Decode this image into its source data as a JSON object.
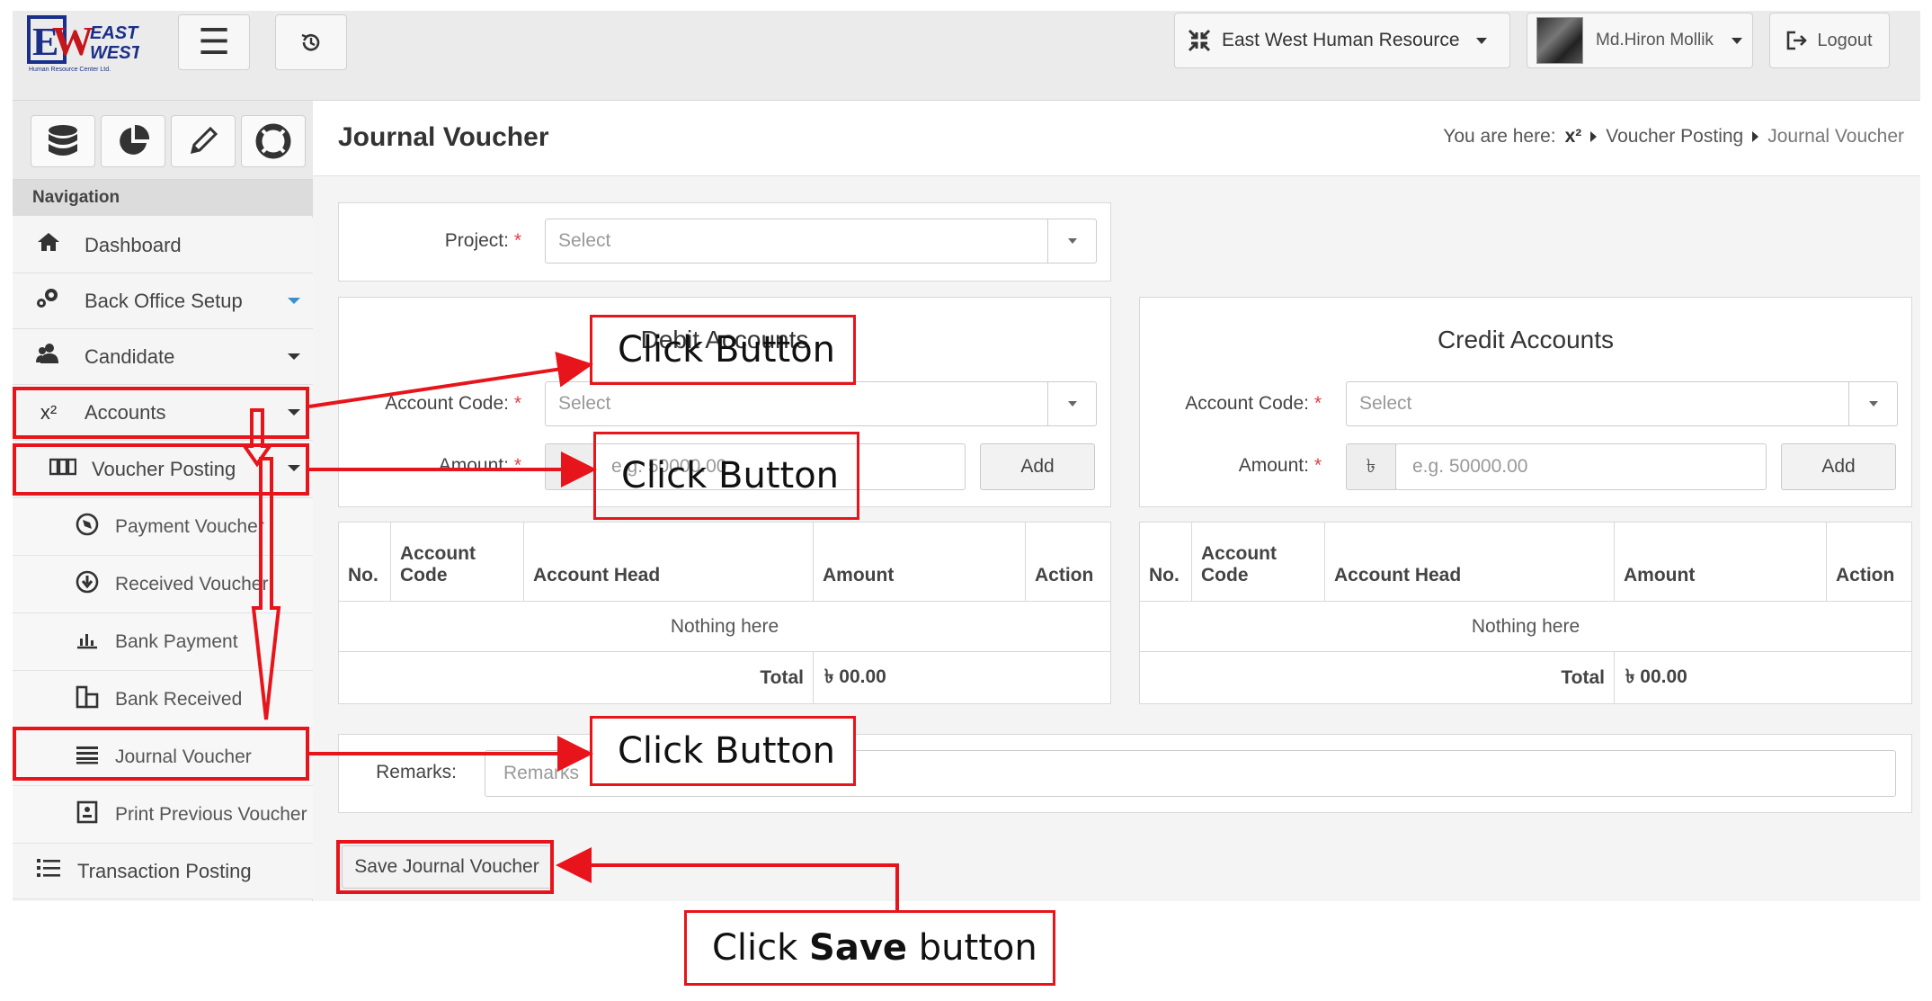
{
  "header": {
    "logo_top": "EAST",
    "logo_bottom": "WEST",
    "logo_tagline": "Human Resource Center Ltd.",
    "company": "East West Human Resource",
    "user": "Md.Hiron Mollik",
    "logout": "Logout"
  },
  "sidebar": {
    "nav_heading": "Navigation",
    "items": [
      {
        "label": "Dashboard"
      },
      {
        "label": "Back Office Setup"
      },
      {
        "label": "Candidate"
      },
      {
        "label": "Accounts"
      },
      {
        "label": "Voucher Posting"
      },
      {
        "label": "Payment Voucher"
      },
      {
        "label": "Received Voucher"
      },
      {
        "label": "Bank Payment"
      },
      {
        "label": "Bank Received"
      },
      {
        "label": "Journal Voucher"
      },
      {
        "label": "Print Previous Voucher"
      },
      {
        "label": "Transaction Posting"
      }
    ],
    "accounts_icon": "x²"
  },
  "page": {
    "title": "Journal Voucher",
    "breadcrumb_prefix": "You are here:",
    "breadcrumb_icon": "x²",
    "breadcrumb_1": "Voucher Posting",
    "breadcrumb_2": "Journal Voucher"
  },
  "form": {
    "project_label": "Project:",
    "project_placeholder": "Select",
    "debit_title": "Debit Accounts",
    "credit_title": "Credit Accounts",
    "account_code_label": "Account Code:",
    "account_code_placeholder": "Select",
    "amount_label": "Amount:",
    "currency": "৳",
    "amount_placeholder": "e.g. 50000.00",
    "add_label": "Add",
    "remarks_label": "Remarks:",
    "remarks_placeholder": "Remarks",
    "save_label": "Save Journal Voucher",
    "required_mark": "*"
  },
  "table": {
    "columns": [
      "No.",
      "Account Code",
      "Account Head",
      "Amount",
      "Action"
    ],
    "empty_text": "Nothing here",
    "total_label": "Total",
    "debit_total": "৳ 00.00",
    "credit_total": "৳ 00.00"
  },
  "annotations": {
    "click_button": "Click Button",
    "save_prefix": "Click",
    "save_bold": "Save",
    "save_suffix": "button",
    "color": "#e8141b"
  }
}
